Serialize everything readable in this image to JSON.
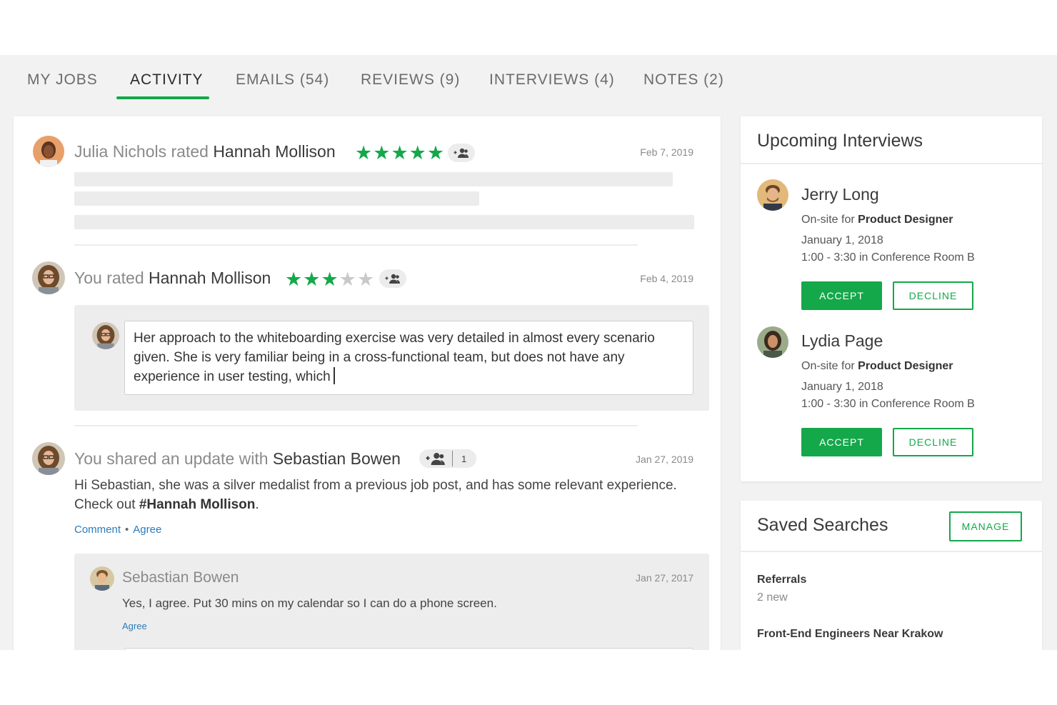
{
  "tabs": [
    {
      "label": "MY JOBS",
      "active": false
    },
    {
      "label": "ACTIVITY",
      "active": true
    },
    {
      "label": "EMAILS (54)",
      "active": false
    },
    {
      "label": "REVIEWS (9)",
      "active": false
    },
    {
      "label": "INTERVIEWS (4)",
      "active": false
    },
    {
      "label": "NOTES (2)",
      "active": false
    }
  ],
  "colors": {
    "accent": "#14a84a",
    "link": "#2b7bbb",
    "star_off": "#c9c9c9"
  },
  "feed": {
    "item1": {
      "actor": "Julia Nichols rated",
      "subject": "Hannah Mollison",
      "rating": 5,
      "max_rating": 5,
      "date": "Feb 7, 2019",
      "icon": "add-person-icon"
    },
    "item2": {
      "actor": "You rated",
      "subject": "Hannah Mollison",
      "rating": 3,
      "max_rating": 5,
      "date": "Feb 4, 2019",
      "icon": "add-person-icon",
      "comment_line1": "Her approach to the whiteboarding exercise was very detailed in almost every scenario",
      "comment_line2": "given. She is very familiar being in a cross-functional team, but does not have any",
      "comment_line3": "experience in user testing, which"
    },
    "item3": {
      "actor": "You shared an update with",
      "subject": "Sebastian Bowen",
      "share_count": "1",
      "date": "Jan 27, 2019",
      "body_line1": "Hi Sebastian, she was a silver medalist from a previous job post, and has some relevant experience.",
      "body_prefix": "Check out ",
      "body_tag": "#Hannah Mollison",
      "body_suffix": ".",
      "comment_link": "Comment",
      "agree_link": "Agree",
      "reply": {
        "name": "Sebastian Bowen",
        "date": "Jan 27, 2017",
        "text": "Yes, I agree. Put 30 mins on my calendar so I can do a phone screen.",
        "agree": "Agree"
      }
    }
  },
  "upcoming": {
    "title": "Upcoming Interviews",
    "items": [
      {
        "name": "Jerry Long",
        "type_prefix": "On-site for ",
        "role": "Product Designer",
        "date": "January 1, 2018",
        "time": "1:00 - 3:30 in Conference Room B",
        "accept": "ACCEPT",
        "decline": "DECLINE"
      },
      {
        "name": "Lydia Page",
        "type_prefix": "On-site for ",
        "role": "Product Designer",
        "date": "January 1, 2018",
        "time": "1:00 - 3:30 in Conference Room B",
        "accept": "ACCEPT",
        "decline": "DECLINE"
      }
    ]
  },
  "saved": {
    "title": "Saved Searches",
    "manage": "MANAGE",
    "items": [
      {
        "name": "Referrals",
        "sub": "2 new"
      },
      {
        "name": "Front-End Engineers Near Krakow",
        "sub": ""
      }
    ]
  }
}
